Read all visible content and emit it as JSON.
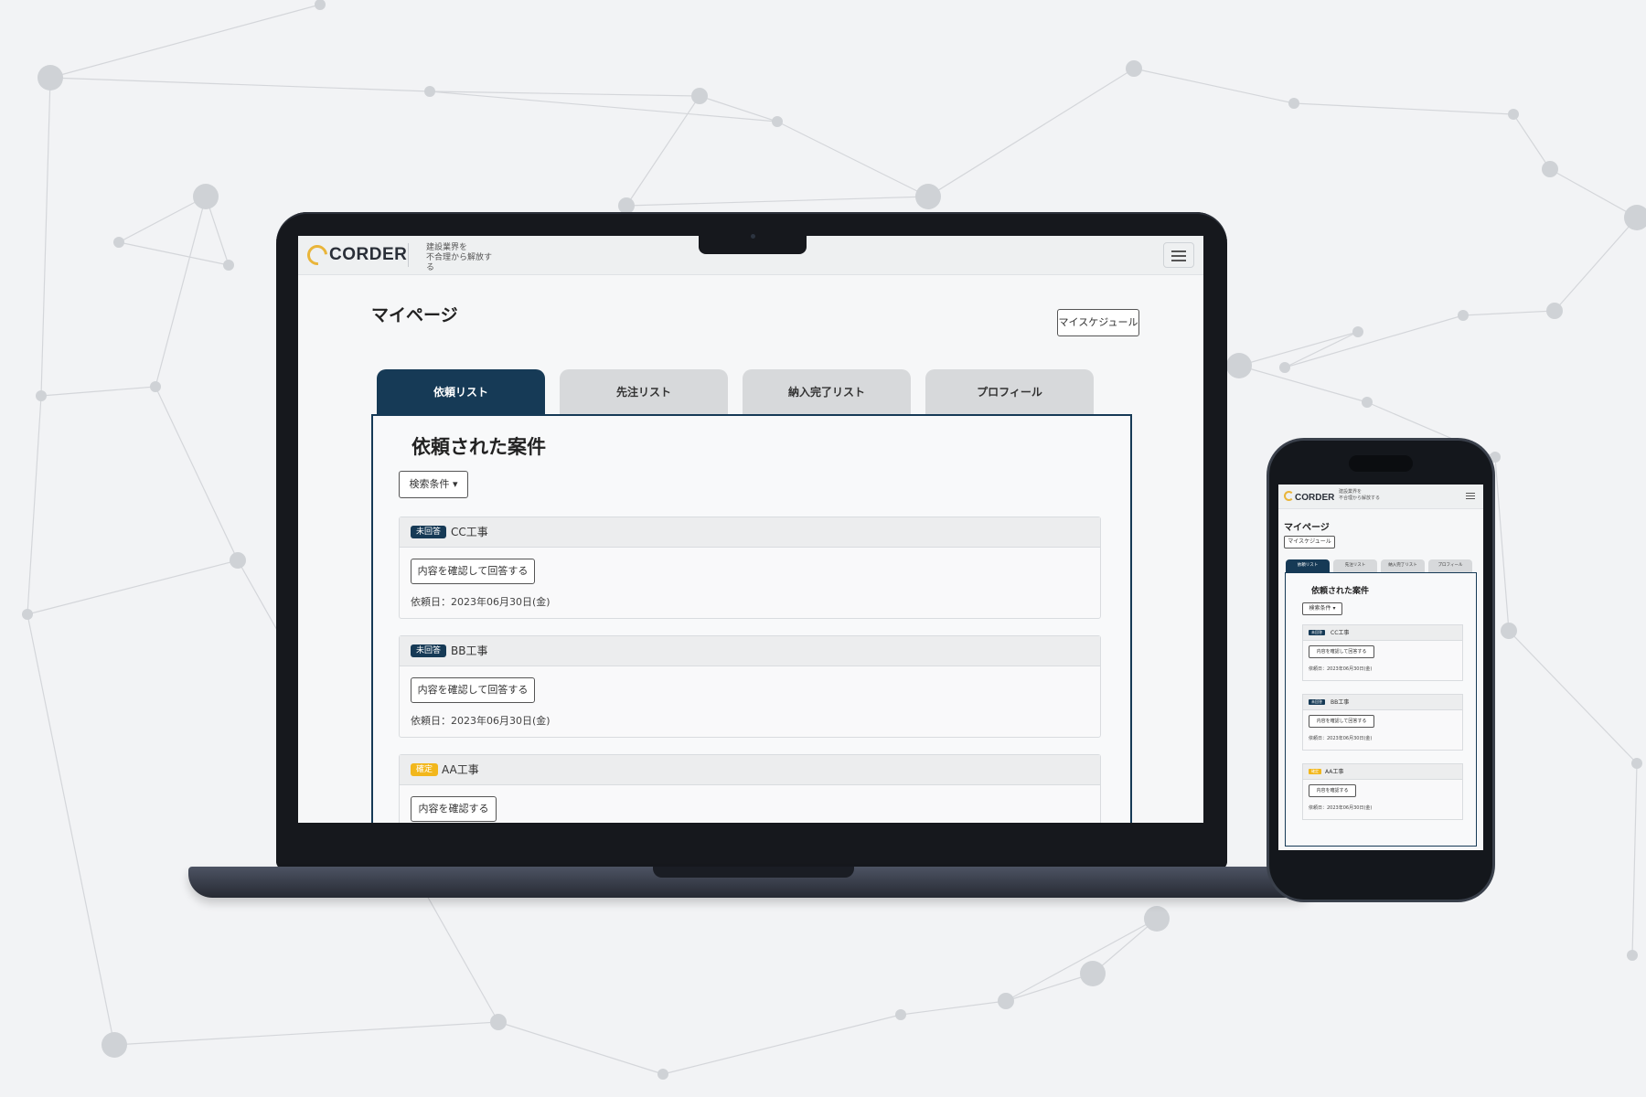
{
  "colors": {
    "primary": "#163a56",
    "accent_logo": "#e9b53a",
    "badge_pending": "#163a56",
    "badge_confirmed": "#f2b71c"
  },
  "header": {
    "logo_text": "CORDER",
    "tagline_line1": "建設業界を",
    "tagline_line2": "不合理から解放する",
    "menu_icon": "hamburger-icon"
  },
  "page": {
    "title": "マイページ",
    "schedule_button": "マイスケジュール"
  },
  "tabs": [
    {
      "label": "依頼リスト",
      "active": true
    },
    {
      "label": "先注リスト",
      "active": false
    },
    {
      "label": "納入完了リスト",
      "active": false
    },
    {
      "label": "プロフィール",
      "active": false
    }
  ],
  "panel": {
    "title": "依頼された案件",
    "filter_button": "検索条件 ▾",
    "cards": [
      {
        "badge": "未回答",
        "name": "CC工事",
        "button": "内容を確認して回答する",
        "date": "依頼日：2023年06月30日(金)"
      },
      {
        "badge": "未回答",
        "name": "BB工事",
        "button": "内容を確認して回答する",
        "date": "依頼日：2023年06月30日(金)"
      },
      {
        "badge": "確定",
        "name": "AA工事",
        "button": "内容を確認する",
        "date": "依頼日：2023年06月30日(金)"
      }
    ]
  }
}
